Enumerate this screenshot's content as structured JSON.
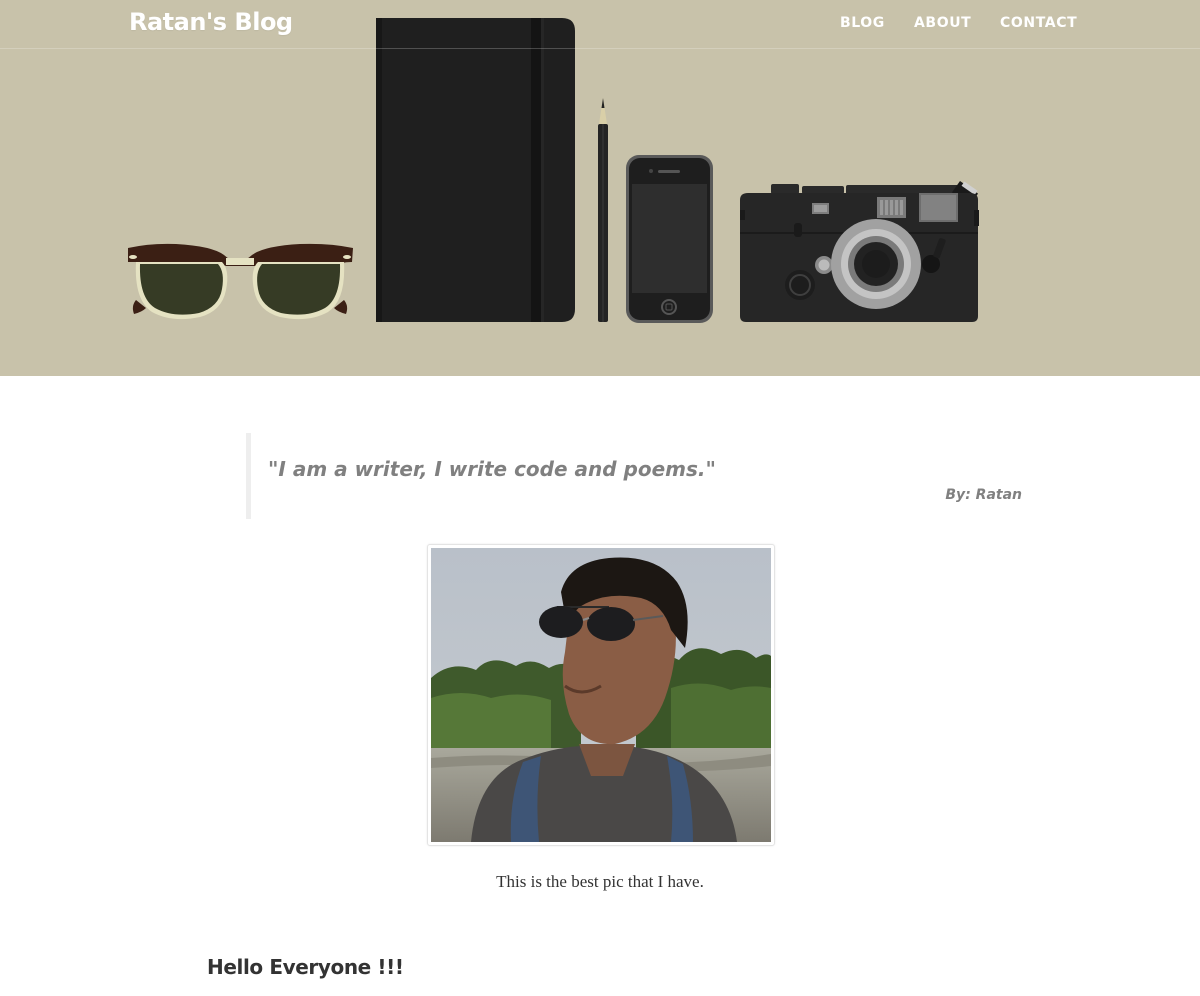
{
  "brand": {
    "title": "Ratan's Blog"
  },
  "nav": {
    "items": [
      {
        "label": "BLOG"
      },
      {
        "label": "ABOUT"
      },
      {
        "label": "CONTACT"
      }
    ]
  },
  "colors": {
    "hero_background": "#c8c2aa",
    "quote_text": "#808080",
    "body_text": "#333333"
  },
  "hero_icons": [
    "sunglasses-icon",
    "notebook-icon",
    "pencil-icon",
    "smartphone-icon",
    "camera-icon"
  ],
  "quote": {
    "text": "\"I am a writer, I write code and poems.\"",
    "author": "By: Ratan"
  },
  "photo": {
    "caption": "This is the best pic that I have."
  },
  "post": {
    "heading": "Hello Everyone !!!"
  }
}
